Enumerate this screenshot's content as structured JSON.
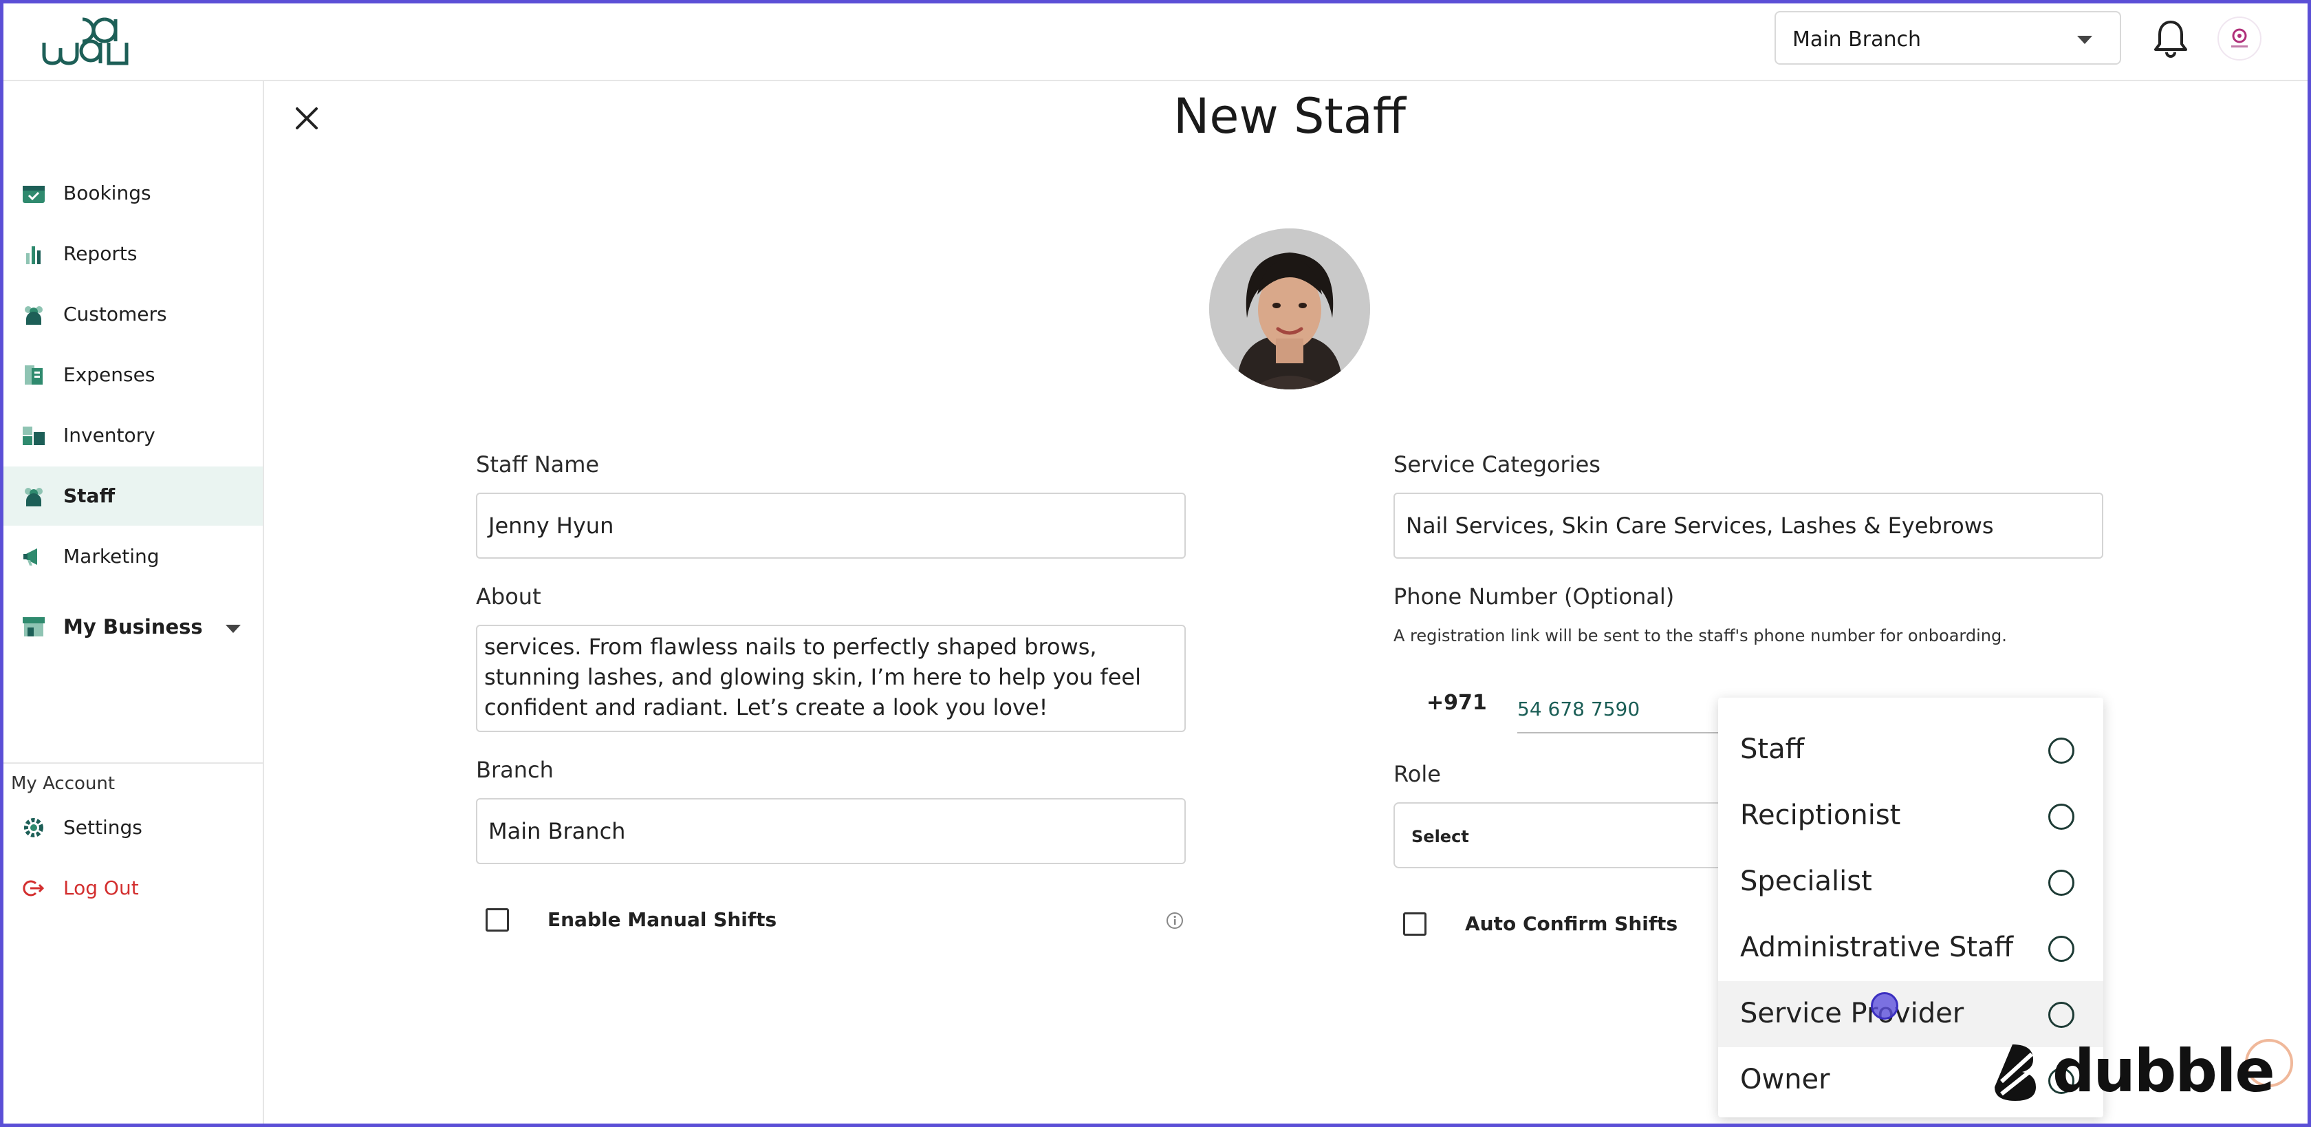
{
  "header": {
    "logo_alt": "waj",
    "branch_select": "Main Branch"
  },
  "sidebar": {
    "items": [
      {
        "label": "Bookings",
        "icon": "calendar-check-icon"
      },
      {
        "label": "Reports",
        "icon": "bar-chart-icon"
      },
      {
        "label": "Customers",
        "icon": "people-icon"
      },
      {
        "label": "Expenses",
        "icon": "receipt-icon"
      },
      {
        "label": "Inventory",
        "icon": "boxes-icon"
      },
      {
        "label": "Staff",
        "icon": "staff-icon"
      },
      {
        "label": "Marketing",
        "icon": "megaphone-icon"
      }
    ],
    "my_business": "My Business",
    "account_title": "My Account",
    "settings": "Settings",
    "logout": "Log Out"
  },
  "form": {
    "title": "New Staff",
    "staff_name_label": "Staff Name",
    "staff_name_value": "Jenny Hyun",
    "about_label": "About",
    "about_value": "services. From flawless nails to perfectly shaped brows, stunning lashes, and glowing skin, I’m here to help you feel confident and radiant. Let’s create a look you love!",
    "branch_label": "Branch",
    "branch_value": "Main Branch",
    "manual_shifts_label": "Enable Manual Shifts",
    "service_categories_label": "Service Categories",
    "service_categories_value": "Nail Services, Skin Care Services, Lashes & Eyebrows",
    "phone_label": "Phone Number (Optional)",
    "phone_hint": "A registration link will be sent to the staff's phone number for onboarding.",
    "phone_prefix": "+971",
    "phone_value": "54 678 7590",
    "role_label": "Role",
    "role_placeholder": "Select",
    "auto_confirm_label": "Auto Confirm Shifts"
  },
  "role_dropdown": {
    "options": [
      "Staff",
      "Reciptionist",
      "Specialist",
      "Administrative Staff",
      "Service Provider",
      "Owner"
    ],
    "hovered_index": 4
  },
  "watermark": "dubble",
  "colors": {
    "brand_teal": "#1d5f57",
    "active_bg": "#eaf4f1",
    "logout_red": "#d32f2f",
    "frame": "#5b4fd6"
  }
}
